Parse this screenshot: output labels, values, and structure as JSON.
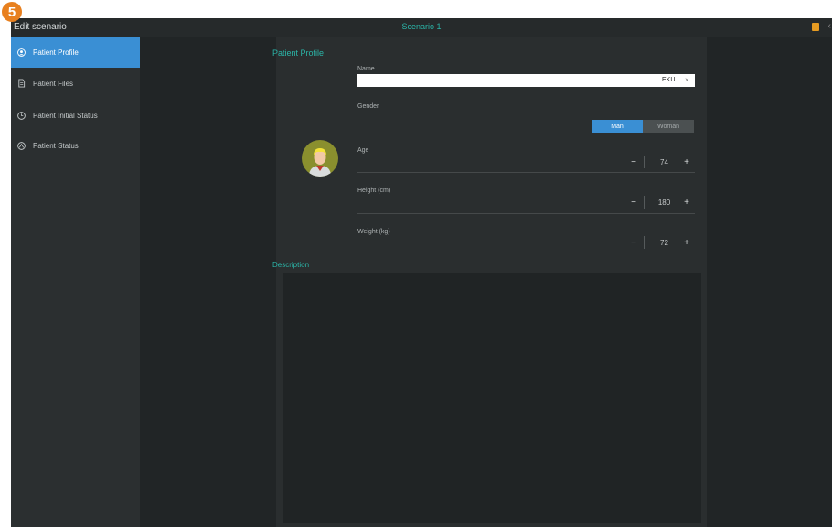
{
  "badge": "5",
  "topbar": {
    "title": "Edit scenario",
    "scenario": "Scenario 1",
    "save_icon": "save-icon",
    "more_icon": "more-icon"
  },
  "sidebar": {
    "items": [
      {
        "label": "Patient Profile",
        "icon": "user-icon",
        "active": true
      },
      {
        "label": "Patient Files",
        "icon": "files-icon"
      },
      {
        "label": "Patient Initial Status",
        "icon": "clock-icon"
      },
      {
        "label": "Patient Status",
        "icon": "status-icon"
      }
    ]
  },
  "profile": {
    "section_title": "Patient Profile",
    "name": {
      "label": "Name",
      "value": "",
      "keyboard": "EKU"
    },
    "gender": {
      "label": "Gender",
      "options": [
        "Man",
        "Woman"
      ],
      "selected": "Man"
    },
    "age": {
      "label": "Age",
      "value": "74"
    },
    "height": {
      "label": "Height (cm)",
      "value": "180"
    },
    "weight": {
      "label": "Weight (kg)",
      "value": "72"
    }
  },
  "description": {
    "title": "Description",
    "value": ""
  },
  "colors": {
    "accent": "#3a8fd4",
    "teal": "#2bb5a8",
    "badge": "#e8801f"
  }
}
